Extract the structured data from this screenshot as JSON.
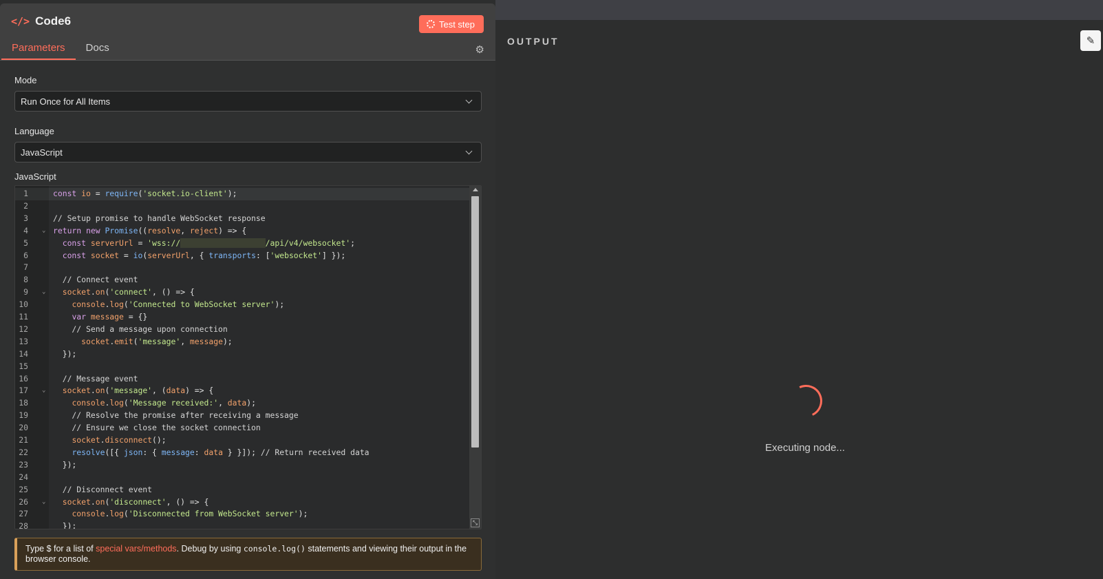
{
  "node": {
    "title": "Code6",
    "test_label": "Test step",
    "icon": "code-icon"
  },
  "tabs": [
    {
      "label": "Parameters",
      "active": true
    },
    {
      "label": "Docs",
      "active": false
    }
  ],
  "mode": {
    "label": "Mode",
    "value": "Run Once for All Items"
  },
  "language": {
    "label": "Language",
    "value": "JavaScript"
  },
  "editor": {
    "label": "JavaScript",
    "lines": [
      [
        [
          "kw",
          "const "
        ],
        [
          "var",
          "io "
        ],
        [
          "punc",
          "= "
        ],
        [
          "fn",
          "require"
        ],
        [
          "punc",
          "("
        ],
        [
          "str",
          "'socket.io-client'"
        ],
        [
          "punc",
          ");"
        ]
      ],
      [],
      [
        [
          "cmt",
          "// Setup promise to handle WebSocket response"
        ]
      ],
      [
        [
          "kw",
          "return new "
        ],
        [
          "fn",
          "Promise"
        ],
        [
          "punc",
          "(("
        ],
        [
          "var",
          "resolve"
        ],
        [
          "punc",
          ", "
        ],
        [
          "var",
          "reject"
        ],
        [
          "punc",
          ") => {"
        ]
      ],
      [
        [
          "punc",
          "  "
        ],
        [
          "kw",
          "const "
        ],
        [
          "var",
          "serverUrl "
        ],
        [
          "punc",
          "= "
        ],
        [
          "str",
          "'wss://"
        ],
        [
          "masked",
          "                  "
        ],
        [
          "str",
          "/api/v4/websocket'"
        ],
        [
          "punc",
          ";"
        ]
      ],
      [
        [
          "punc",
          "  "
        ],
        [
          "kw",
          "const "
        ],
        [
          "var",
          "socket "
        ],
        [
          "punc",
          "= "
        ],
        [
          "fn",
          "io"
        ],
        [
          "punc",
          "("
        ],
        [
          "var",
          "serverUrl"
        ],
        [
          "punc",
          ", { "
        ],
        [
          "fn",
          "transports"
        ],
        [
          "punc",
          ": ["
        ],
        [
          "str",
          "'websocket'"
        ],
        [
          "punc",
          "] });"
        ]
      ],
      [],
      [
        [
          "cmt",
          "  // Connect event"
        ]
      ],
      [
        [
          "punc",
          "  "
        ],
        [
          "var",
          "socket"
        ],
        [
          "punc",
          "."
        ],
        [
          "var",
          "on"
        ],
        [
          "punc",
          "("
        ],
        [
          "str",
          "'connect'"
        ],
        [
          "punc",
          ", () => {"
        ]
      ],
      [
        [
          "punc",
          "    "
        ],
        [
          "var",
          "console"
        ],
        [
          "punc",
          "."
        ],
        [
          "var",
          "log"
        ],
        [
          "punc",
          "("
        ],
        [
          "str",
          "'Connected to WebSocket server'"
        ],
        [
          "punc",
          ");"
        ]
      ],
      [
        [
          "punc",
          "    "
        ],
        [
          "kw",
          "var "
        ],
        [
          "var",
          "message "
        ],
        [
          "punc",
          "= {}"
        ]
      ],
      [
        [
          "cmt",
          "    // Send a message upon connection"
        ]
      ],
      [
        [
          "punc",
          "      "
        ],
        [
          "var",
          "socket"
        ],
        [
          "punc",
          "."
        ],
        [
          "var",
          "emit"
        ],
        [
          "punc",
          "("
        ],
        [
          "str",
          "'message'"
        ],
        [
          "punc",
          ", "
        ],
        [
          "var",
          "message"
        ],
        [
          "punc",
          ");"
        ]
      ],
      [
        [
          "punc",
          "  });"
        ]
      ],
      [],
      [
        [
          "cmt",
          "  // Message event"
        ]
      ],
      [
        [
          "punc",
          "  "
        ],
        [
          "var",
          "socket"
        ],
        [
          "punc",
          "."
        ],
        [
          "var",
          "on"
        ],
        [
          "punc",
          "("
        ],
        [
          "str",
          "'message'"
        ],
        [
          "punc",
          ", ("
        ],
        [
          "var",
          "data"
        ],
        [
          "punc",
          ") => {"
        ]
      ],
      [
        [
          "punc",
          "    "
        ],
        [
          "var",
          "console"
        ],
        [
          "punc",
          "."
        ],
        [
          "var",
          "log"
        ],
        [
          "punc",
          "("
        ],
        [
          "str",
          "'Message received:'"
        ],
        [
          "punc",
          ", "
        ],
        [
          "var",
          "data"
        ],
        [
          "punc",
          ");"
        ]
      ],
      [
        [
          "cmt",
          "    // Resolve the promise after receiving a message"
        ]
      ],
      [
        [
          "cmt",
          "    // Ensure we close the socket connection"
        ]
      ],
      [
        [
          "punc",
          "    "
        ],
        [
          "var",
          "socket"
        ],
        [
          "punc",
          "."
        ],
        [
          "var",
          "disconnect"
        ],
        [
          "punc",
          "();"
        ]
      ],
      [
        [
          "punc",
          "    "
        ],
        [
          "fn",
          "resolve"
        ],
        [
          "punc",
          "([{ "
        ],
        [
          "fn",
          "json"
        ],
        [
          "punc",
          ": { "
        ],
        [
          "fn",
          "message"
        ],
        [
          "punc",
          ": "
        ],
        [
          "var",
          "data "
        ],
        [
          "punc",
          "} }]); "
        ],
        [
          "cmt",
          "// Return received data"
        ]
      ],
      [
        [
          "punc",
          "  });"
        ]
      ],
      [],
      [
        [
          "cmt",
          "  // Disconnect event"
        ]
      ],
      [
        [
          "punc",
          "  "
        ],
        [
          "var",
          "socket"
        ],
        [
          "punc",
          "."
        ],
        [
          "var",
          "on"
        ],
        [
          "punc",
          "("
        ],
        [
          "str",
          "'disconnect'"
        ],
        [
          "punc",
          ", () => {"
        ]
      ],
      [
        [
          "punc",
          "    "
        ],
        [
          "var",
          "console"
        ],
        [
          "punc",
          "."
        ],
        [
          "var",
          "log"
        ],
        [
          "punc",
          "("
        ],
        [
          "str",
          "'Disconnected from WebSocket server'"
        ],
        [
          "punc",
          ");"
        ]
      ],
      [
        [
          "punc",
          "  });"
        ]
      ]
    ],
    "fold_lines": [
      4,
      9,
      17,
      26
    ]
  },
  "notice": {
    "prefix": "Type $ for a list of ",
    "link": "special vars/methods",
    "middle": ". Debug by using ",
    "code": "console.log()",
    "suffix": " statements and viewing their output in the browser console."
  },
  "output": {
    "title": "OUTPUT",
    "status": "Executing node...",
    "edit_icon": "pencil-icon"
  },
  "colors": {
    "accent": "#ff6d5a"
  }
}
